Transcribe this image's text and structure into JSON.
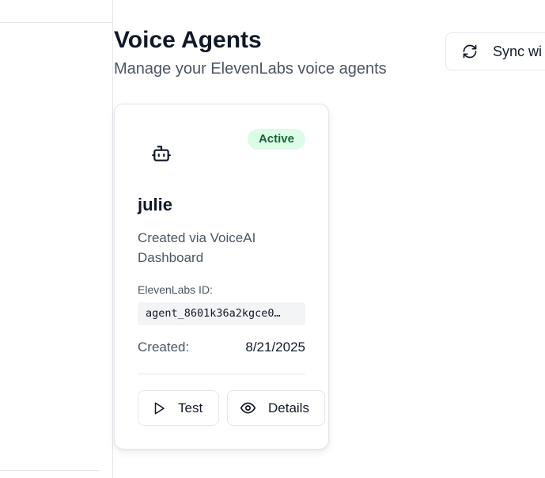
{
  "header": {
    "title": "Voice Agents",
    "subtitle": "Manage your ElevenLabs voice agents",
    "sync_label": "Sync wi"
  },
  "agents": [
    {
      "icon": "bot-icon",
      "status": "Active",
      "name": "julie",
      "description": "Created via VoiceAI Dashboard",
      "id_label": "ElevenLabs ID:",
      "id_value": "agent_8601k36a2kgce0…",
      "created_label": "Created:",
      "created_value": "8/21/2025",
      "test_label": "Test",
      "details_label": "Details"
    }
  ],
  "colors": {
    "status_bg": "#dcfce7",
    "status_text": "#166534",
    "border": "#e5e7eb",
    "muted_text": "#4b5563"
  }
}
